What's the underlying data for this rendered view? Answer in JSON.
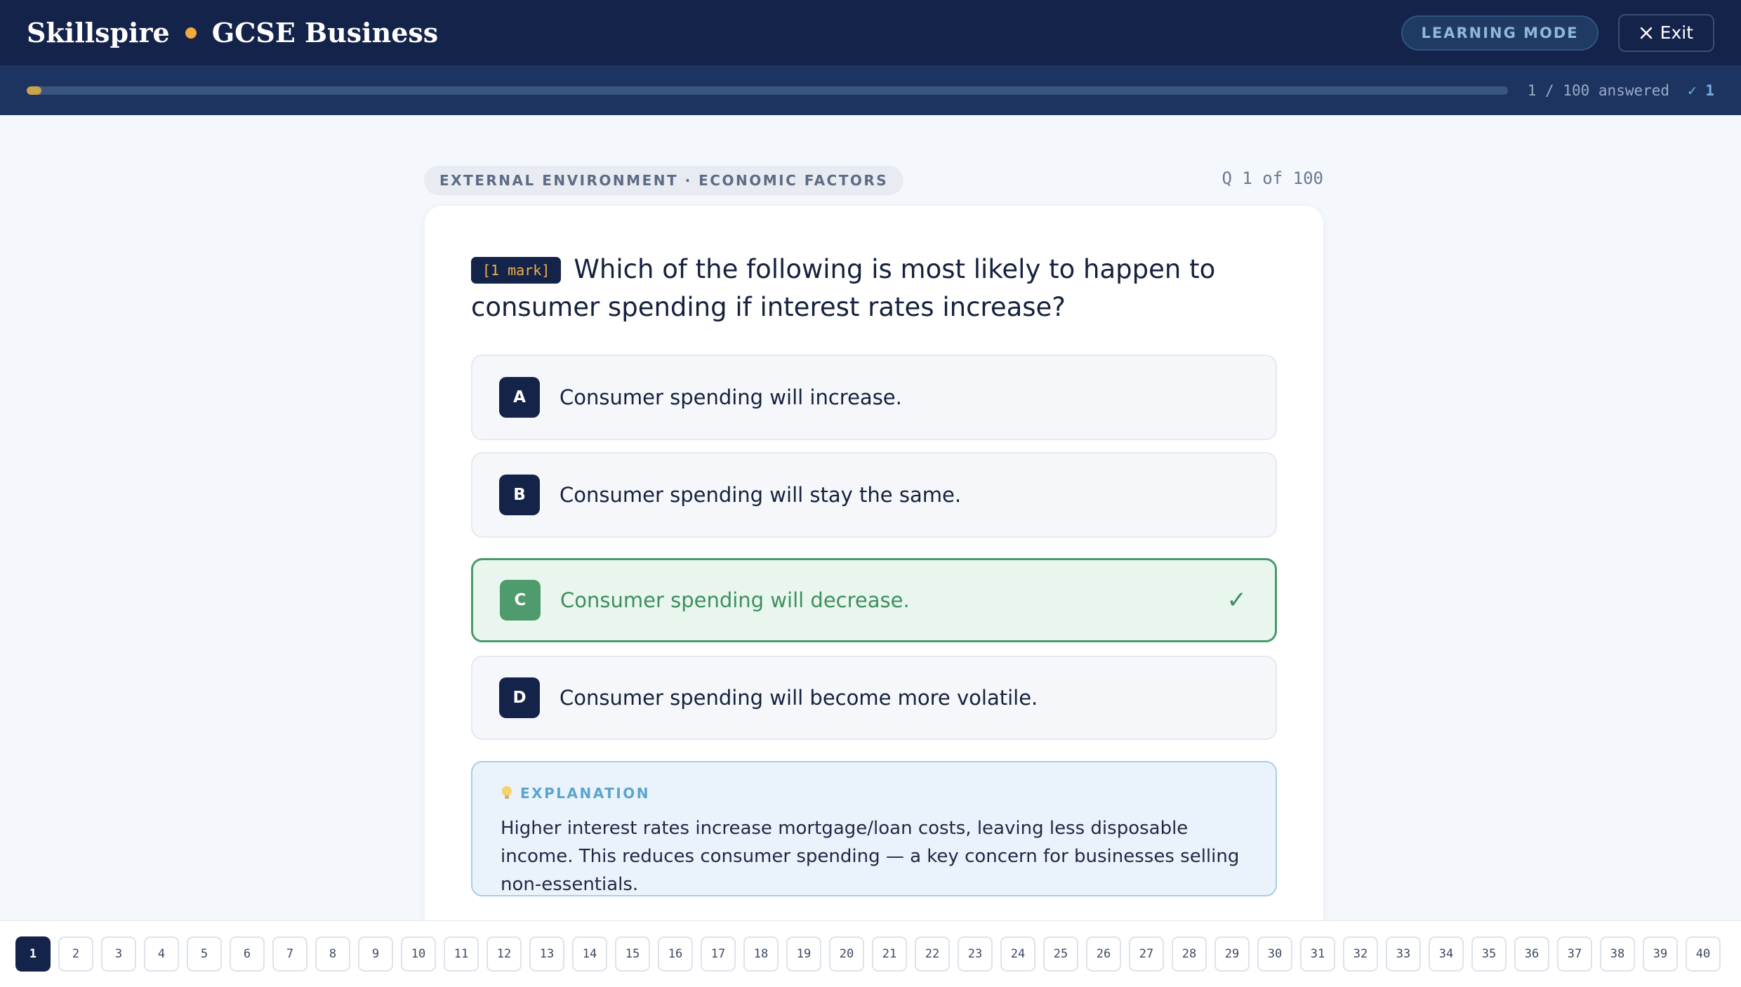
{
  "header": {
    "brand": "Skillspire",
    "course": "GCSE Business",
    "mode_label": "LEARNING MODE",
    "exit_label": "Exit"
  },
  "progress": {
    "fraction": 0.01,
    "answered_text": "1 / 100 answered",
    "correct_text": "✓ 1"
  },
  "meta": {
    "topic": "EXTERNAL ENVIRONMENT · ECONOMIC FACTORS",
    "question_counter": "Q 1 of 100"
  },
  "question": {
    "marks": "[1 mark]",
    "text": "Which of the following is most likely to happen to consumer spending if interest rates increase?"
  },
  "options": [
    {
      "letter": "A",
      "text": "Consumer spending will increase."
    },
    {
      "letter": "B",
      "text": "Consumer spending will stay the same."
    },
    {
      "letter": "C",
      "text": "Consumer spending will decrease.",
      "correct": "✓"
    },
    {
      "letter": "D",
      "text": "Consumer spending will become more volatile."
    }
  ],
  "explanation": {
    "label": "EXPLANATION",
    "text": "Higher interest rates increase mortgage/loan costs, leaving less disposable income. This reduces consumer spending — a key concern for businesses selling non-essentials."
  },
  "question_nav": [
    "1",
    "2",
    "3",
    "4",
    "5",
    "6",
    "7",
    "8",
    "9",
    "10",
    "11",
    "12",
    "13",
    "14",
    "15",
    "16",
    "17",
    "18",
    "19",
    "20",
    "21",
    "22",
    "23",
    "24",
    "25",
    "26",
    "27",
    "28",
    "29",
    "30",
    "31",
    "32",
    "33",
    "34",
    "35",
    "36",
    "37",
    "38",
    "39",
    "40"
  ],
  "colors": {
    "navy": "#14234a",
    "accent_gold": "#f0a93b",
    "correct_green": "#4a9a6a",
    "explain_blue": "#5ba5cf"
  }
}
